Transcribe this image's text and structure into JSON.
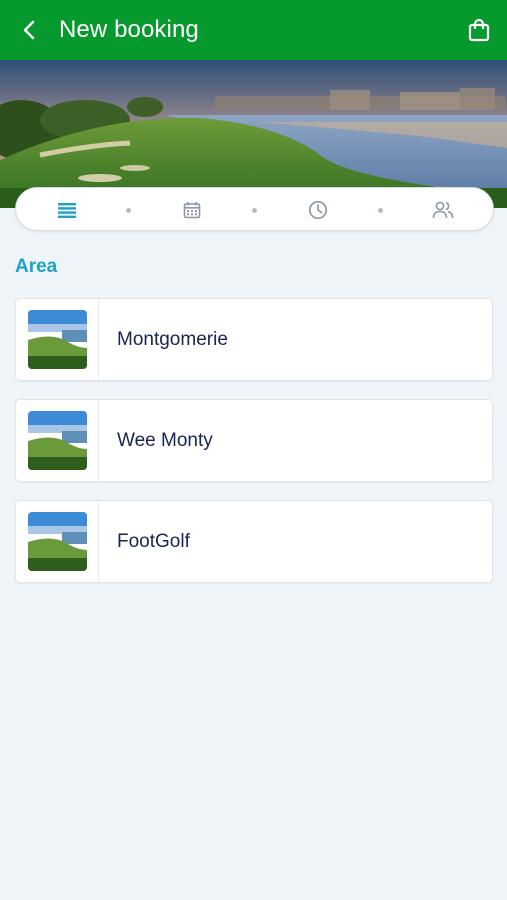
{
  "app_bar": {
    "title": "New booking",
    "back_icon": "chevron-left-icon",
    "cart_icon": "shopping-bag-icon",
    "color": "#069a2e"
  },
  "hero": {
    "image": "golf-course-lake-landscape"
  },
  "stepper": {
    "steps": [
      {
        "icon": "list-icon",
        "active": true
      },
      {
        "icon": "calendar-icon",
        "active": false
      },
      {
        "icon": "clock-icon",
        "active": false
      },
      {
        "icon": "users-icon",
        "active": false
      }
    ],
    "active_color": "#1fa2c8",
    "inactive_color": "#8d96a8"
  },
  "section": {
    "title": "Area"
  },
  "areas": [
    {
      "name": "Montgomerie"
    },
    {
      "name": "Wee Monty"
    },
    {
      "name": "FootGolf"
    }
  ]
}
